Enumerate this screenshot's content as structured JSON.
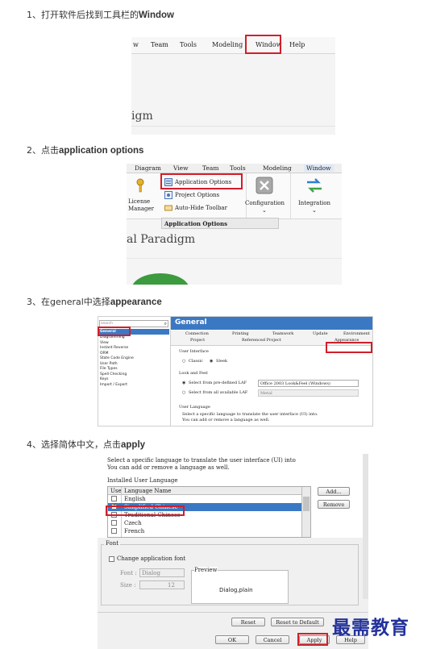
{
  "steps": [
    {
      "prefix": "1、打开软件后找到工具栏的",
      "bold": "Window"
    },
    {
      "prefix": "2、点击",
      "bold": "application options"
    },
    {
      "prefix": "3、在general中选择",
      "bold": "appearance"
    },
    {
      "prefix": "4、选择简体中文，点击",
      "bold": "apply"
    }
  ],
  "shot1": {
    "menu": [
      "w",
      "Team",
      "Tools",
      "Modeling",
      "Window",
      "Help"
    ],
    "fragment": "igm"
  },
  "shot2": {
    "menu": [
      "Diagram",
      "View",
      "Team",
      "Tools",
      "Modeling",
      "Window"
    ],
    "items": [
      "Application Options",
      "Project Options",
      "Auto-Hide Toolbar"
    ],
    "left_label": [
      "License",
      "Manager"
    ],
    "configuration": "Configuration",
    "integration": "Integration",
    "group_label": "Application Options",
    "fragment": "al Paradigm"
  },
  "shot3": {
    "search_placeholder": "search",
    "nav": [
      "General",
      "Diagramming",
      "View",
      "Instant Reverse",
      "ORM",
      "State Code Engine",
      "User Path",
      "File Types",
      "Spell Checking",
      "Keys",
      "Import / Export"
    ],
    "header": "General",
    "tabs_row1": [
      "Connection",
      "Printing",
      "Teamwork",
      "Update",
      "Environment"
    ],
    "tabs_row2": [
      "Project",
      "Referenced Project",
      "Appearance"
    ],
    "ui_label": "User Interface",
    "classic": "Classic",
    "sleek": "Sleek",
    "laf_label": "Look and Feel",
    "laf_pre": "Select from pre-defined LAF",
    "laf_pre_value": "Office 2003 Look&Feel (Windows)",
    "laf_all": "Select from all available LAF",
    "laf_all_value": "Metal",
    "lang_label": "User Language",
    "lang_desc1": "Select a specific language to translate the user interface (UI) into.",
    "lang_desc2": "You can add or remove a language as well."
  },
  "shot4": {
    "desc1": "Select a specific language to translate the user interface (UI) into",
    "desc2": "You can add or remove a language as well.",
    "installed_label": "Installed User Language",
    "col_use": "Use",
    "col_name": "Language Name",
    "languages": [
      "English",
      "Simplified Chinese",
      "Traditional Chinese",
      "Czech",
      "French"
    ],
    "add_btn": "Add...",
    "remove_btn": "Remove",
    "font_section": "Font",
    "change_font": "Change application font",
    "font_label": "Font :",
    "font_value": "Dialog",
    "size_label": "Size :",
    "size_value": "12",
    "preview_label": "Preview",
    "preview_text": "Dialog,plain",
    "reset_btn": "Reset",
    "reset_default_btn": "Reset to Default",
    "ok_btn": "OK",
    "cancel_btn": "Cancel",
    "apply_btn": "Apply",
    "help_btn": "Help"
  },
  "watermark": "最需教育",
  "colors": {
    "highlight": "#d11f2a",
    "selection": "#3b78c4",
    "watermark": "#23329a"
  }
}
